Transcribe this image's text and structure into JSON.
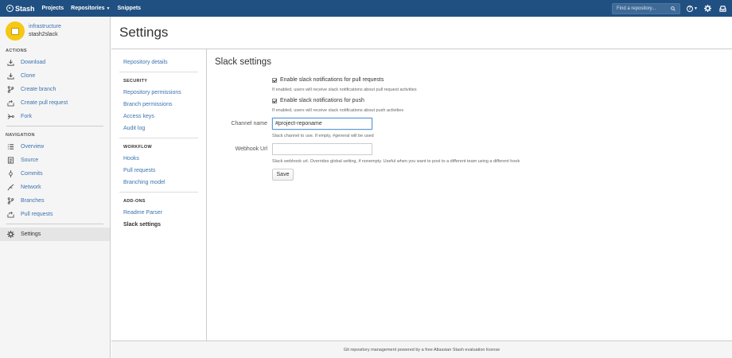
{
  "topbar": {
    "logo": "Stash",
    "nav": [
      "Projects",
      "Repositories",
      "Snippets"
    ],
    "search_placeholder": "Find a repository...",
    "icons": [
      "help-icon",
      "gear-icon",
      "inbox-icon"
    ]
  },
  "sidebar": {
    "project": "infrastructure",
    "repo": "stash2slack",
    "actions_title": "ACTIONS",
    "actions": [
      {
        "label": "Download",
        "icon": "download-icon"
      },
      {
        "label": "Clone",
        "icon": "clone-icon"
      },
      {
        "label": "Create branch",
        "icon": "branch-icon"
      },
      {
        "label": "Create pull request",
        "icon": "pull-request-icon"
      },
      {
        "label": "Fork",
        "icon": "fork-icon"
      }
    ],
    "navigation_title": "NAVIGATION",
    "navigation": [
      {
        "label": "Overview",
        "icon": "overview-icon"
      },
      {
        "label": "Source",
        "icon": "source-icon"
      },
      {
        "label": "Commits",
        "icon": "commits-icon"
      },
      {
        "label": "Network",
        "icon": "network-icon"
      },
      {
        "label": "Branches",
        "icon": "branches-icon"
      },
      {
        "label": "Pull requests",
        "icon": "pull-requests-icon"
      }
    ],
    "settings_label": "Settings"
  },
  "page": {
    "title": "Settings"
  },
  "settings_nav": {
    "repository_details": "Repository details",
    "security_title": "SECURITY",
    "security": [
      "Repository permissions",
      "Branch permissions",
      "Access keys",
      "Audit log"
    ],
    "workflow_title": "WORKFLOW",
    "workflow": [
      "Hooks",
      "Pull requests",
      "Branching model"
    ],
    "addons_title": "ADD-ONS",
    "addons": [
      "Readme Parser",
      "Slack settings"
    ]
  },
  "form": {
    "heading": "Slack settings",
    "pr_checkbox_label": "Enable slack notifications for pull requests",
    "pr_checkbox_checked": true,
    "pr_description": "If enabled, users will receive slack notifications about pull request activities",
    "push_checkbox_label": "Enable slack notifications for push",
    "push_checkbox_checked": true,
    "push_description": "If enabled, users will receive slack notifications about push activities",
    "channel_label": "Channel name",
    "channel_value": "#project-reponame",
    "channel_description": "Slack channel to use. If empty, #general will be used",
    "webhook_label": "Webhook Url",
    "webhook_value": "",
    "webhook_description": "Slack webhook url. Overrides global setting, if nonempty. Useful when you want to post to a different team using a different hook",
    "save_label": "Save"
  },
  "footer": {
    "text": "Git repository management powered by a free Atlassian Stash evaluation license"
  }
}
